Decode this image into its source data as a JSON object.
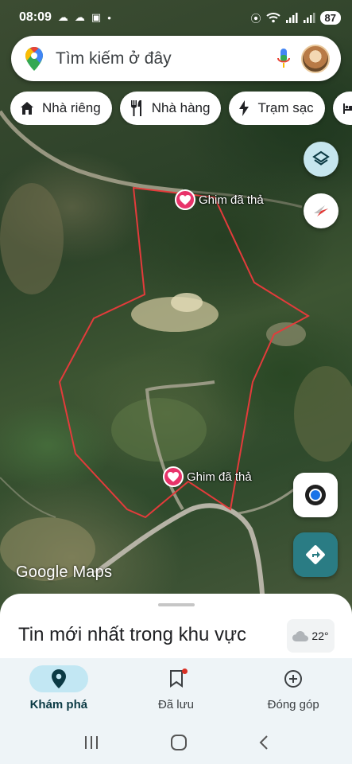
{
  "status_bar": {
    "time": "08:09",
    "battery": "87",
    "icons": [
      "cloud-icon",
      "cloud-icon",
      "screenshot-icon",
      "dot-icon",
      "location-icon",
      "wifi-icon",
      "signal-icon",
      "signal-icon"
    ]
  },
  "search": {
    "placeholder": "Tìm kiếm ở đây",
    "icons": [
      "maps-pin-logo-icon",
      "microphone-icon",
      "avatar"
    ]
  },
  "chips": [
    {
      "label": "Nhà riêng",
      "icon": "home-icon"
    },
    {
      "label": "Nhà hàng",
      "icon": "restaurant-icon"
    },
    {
      "label": "Trạm sạc",
      "icon": "charging-icon"
    },
    {
      "label": "",
      "icon": "hotel-icon"
    }
  ],
  "map": {
    "pins": [
      {
        "label": "Ghim đã thả",
        "icon": "heart-icon"
      },
      {
        "label": "Ghim đã thả",
        "icon": "heart-icon"
      }
    ],
    "logo": "Google Maps",
    "controls": [
      "layers-icon",
      "compass-icon",
      "my-location-icon",
      "directions-icon"
    ],
    "colors": {
      "boundary": "#e33b3b",
      "pin": "#e8336a",
      "directions": "#2a7c84"
    }
  },
  "sheet": {
    "title": "Tin mới nhất trong khu vực",
    "weather": "22°",
    "weather_icon": "cloud-icon"
  },
  "nav": {
    "items": [
      {
        "label": "Khám phá",
        "icon": "explore-pin-icon",
        "active": true
      },
      {
        "label": "Đã lưu",
        "icon": "bookmark-icon",
        "active": false
      },
      {
        "label": "Đóng góp",
        "icon": "add-circle-icon",
        "active": false
      }
    ]
  },
  "system_nav": [
    "recents-icon",
    "home-icon",
    "back-icon"
  ]
}
